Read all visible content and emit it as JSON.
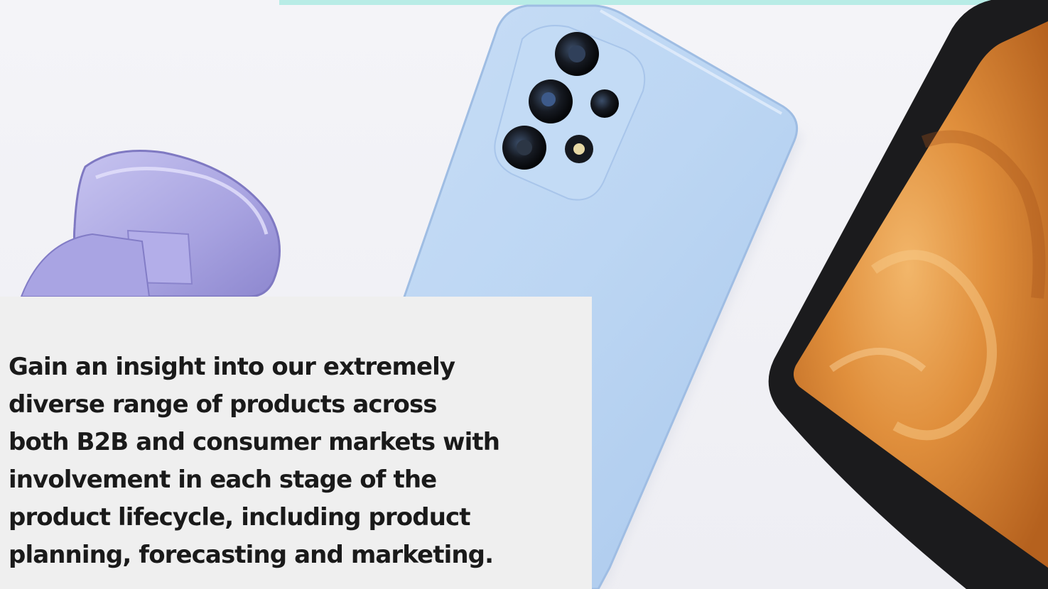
{
  "banner": {
    "strip_color": "#b8ece6",
    "panel_color": "#efefef",
    "text_color": "#1a1a1a",
    "image_label": "product-hero-image",
    "description_lines": [
      "Gain an insight into our extremely",
      "diverse range of products across",
      "both B2B and consumer markets with",
      "involvement in each stage of the",
      "product lifecycle, including product",
      "planning, forecasting and marketing."
    ]
  }
}
